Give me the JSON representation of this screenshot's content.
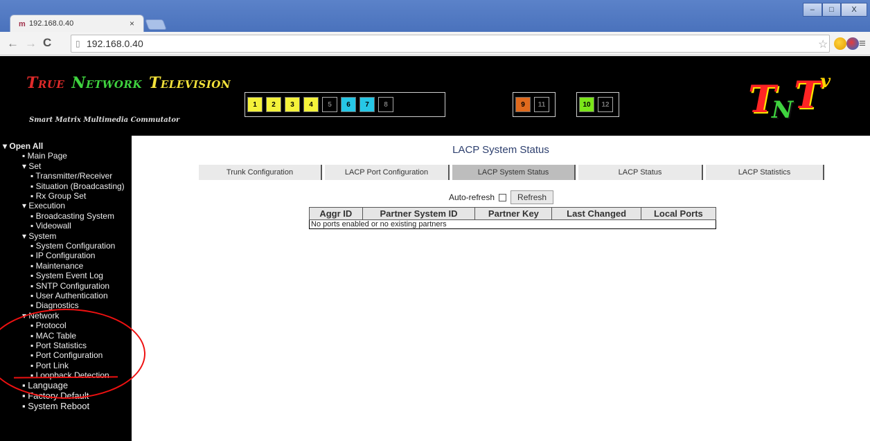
{
  "browser": {
    "tab_favicon": "m",
    "tab_title": "192.168.0.40",
    "tab_close": "×",
    "url": "192.168.0.40",
    "window_controls": [
      "–",
      "□",
      "X"
    ]
  },
  "header": {
    "brand_words": [
      {
        "cap": "T",
        "rest": "RUE",
        "color": "#e02a2a"
      },
      {
        "cap": "N",
        "rest": "ETWORK",
        "color": "#3fd33f"
      },
      {
        "cap": "T",
        "rest": "ELEVISION",
        "color": "#f3e23a"
      }
    ],
    "tagline": "Smart Matrix Multimedia Commutator",
    "ports_group1": [
      {
        "label": "1",
        "color": "#f4f23a"
      },
      {
        "label": "2",
        "color": "#f4f23a"
      },
      {
        "label": "3",
        "color": "#f4f23a"
      },
      {
        "label": "4",
        "color": "#f4f23a"
      },
      {
        "label": "5",
        "color": "#000000"
      },
      {
        "label": "6",
        "color": "#26c7e6"
      },
      {
        "label": "7",
        "color": "#26c7e6"
      },
      {
        "label": "8",
        "color": "#000000"
      }
    ],
    "ports_group2": [
      {
        "label": "9",
        "color": "#e06a1d"
      },
      {
        "label": "11",
        "color": "#000000"
      }
    ],
    "ports_group3": [
      {
        "label": "10",
        "color": "#7be619"
      },
      {
        "label": "12",
        "color": "#000000"
      }
    ],
    "logo_text": [
      "T",
      "N",
      "T",
      "v"
    ]
  },
  "sidebar": {
    "items": [
      {
        "label": "▾ Open All",
        "style": "bold"
      },
      {
        "label": "▪ Main Page"
      },
      {
        "label": "▾ Set"
      },
      {
        "label": "▪ Transmitter/Receiver"
      },
      {
        "label": "▪ Situation (Broadcasting)"
      },
      {
        "label": "▪ Rx Group Set"
      },
      {
        "label": "▾ Execution"
      },
      {
        "label": "▪ Broadcasting System"
      },
      {
        "label": "▪ Videowall"
      },
      {
        "label": "▾ System"
      },
      {
        "label": "▪ System Configuration"
      },
      {
        "label": "▪ IP Configuration"
      },
      {
        "label": "▪ Maintenance"
      },
      {
        "label": "▪ System Event Log"
      },
      {
        "label": "▪ SNTP Configuration"
      },
      {
        "label": "▪ User Authentication"
      },
      {
        "label": "▪ Diagnostics"
      },
      {
        "label": "▾ Network"
      },
      {
        "label": "▪ Protocol"
      },
      {
        "label": "▪ MAC Table"
      },
      {
        "label": "▪ Port Statistics"
      },
      {
        "label": "▪ Port Configuration"
      },
      {
        "label": "▪ Port Link"
      },
      {
        "label": "▪ Loopback Detection"
      },
      {
        "label": "▪ Language",
        "style": "big"
      },
      {
        "label": "▪ Factory Default",
        "style": "big"
      },
      {
        "label": "▪ System Reboot",
        "style": "big"
      }
    ]
  },
  "main": {
    "title": "LACP System Status",
    "tabs": [
      {
        "label": "Trunk Configuration",
        "active": false
      },
      {
        "label": "LACP Port Configuration",
        "active": false
      },
      {
        "label": "LACP System Status",
        "active": true
      },
      {
        "label": "LACP Status",
        "active": false
      },
      {
        "label": "LACP Statistics",
        "active": false
      }
    ],
    "auto_refresh_label": "Auto-refresh",
    "refresh_button": "Refresh",
    "table": {
      "headers": [
        "Aggr ID",
        "Partner System ID",
        "Partner Key",
        "Last Changed",
        "Local Ports"
      ],
      "empty_message": "No ports enabled or no existing partners"
    }
  }
}
